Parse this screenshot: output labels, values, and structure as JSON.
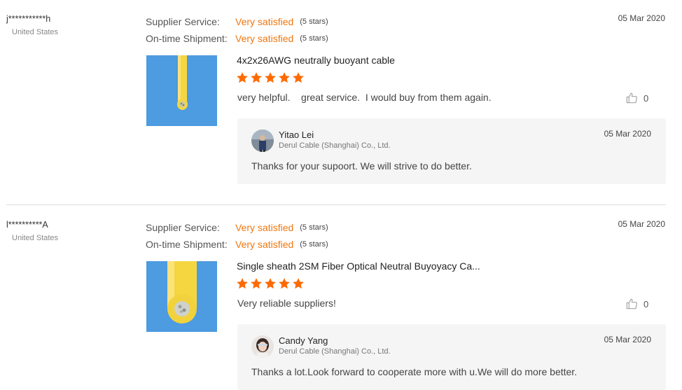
{
  "reviews": [
    {
      "buyer": "j***********h",
      "country": "United States",
      "date": "05 Mar 2020",
      "supplier_service_label": "Supplier Service:",
      "supplier_service_value": "Very satisfied",
      "supplier_service_stars": "(5 stars)",
      "shipment_label": "On-time Shipment:",
      "shipment_value": "Very satisfied",
      "shipment_stars": "(5 stars)",
      "product_title": "4x2x26AWG neutrally buoyant cable",
      "rating": 5,
      "comment": "very helpful.    great service.  I would buy from them again.",
      "likes": "0",
      "reply": {
        "name": "Yitao Lei",
        "company": "Derul Cable (Shanghai) Co., Ltd.",
        "date": "05 Mar 2020",
        "text": "Thanks for your supoort. We will strive to do better."
      }
    },
    {
      "buyer": "l**********A",
      "country": "United States",
      "date": "05 Mar 2020",
      "supplier_service_label": "Supplier Service:",
      "supplier_service_value": "Very satisfied",
      "supplier_service_stars": "(5 stars)",
      "shipment_label": "On-time Shipment:",
      "shipment_value": "Very satisfied",
      "shipment_stars": "(5 stars)",
      "product_title": "Single sheath 2SM Fiber Optical Neutral Buyoyacy Ca...",
      "rating": 5,
      "comment": "Very reliable suppliers!",
      "likes": "0",
      "reply": {
        "name": "Candy Yang",
        "company": "Derul Cable (Shanghai) Co., Ltd.",
        "date": "05 Mar 2020",
        "text": "Thanks a lot.Look forward to cooperate more with u.We will do more better."
      }
    }
  ],
  "colors": {
    "accent": "#f2760d",
    "star": "#ff6a00",
    "thumb_bg": "#4d9be0",
    "cable": "#f5d640",
    "reply_bg": "#f5f5f5"
  },
  "icons": {
    "star": "star-icon",
    "like": "thumbs-up-icon"
  }
}
